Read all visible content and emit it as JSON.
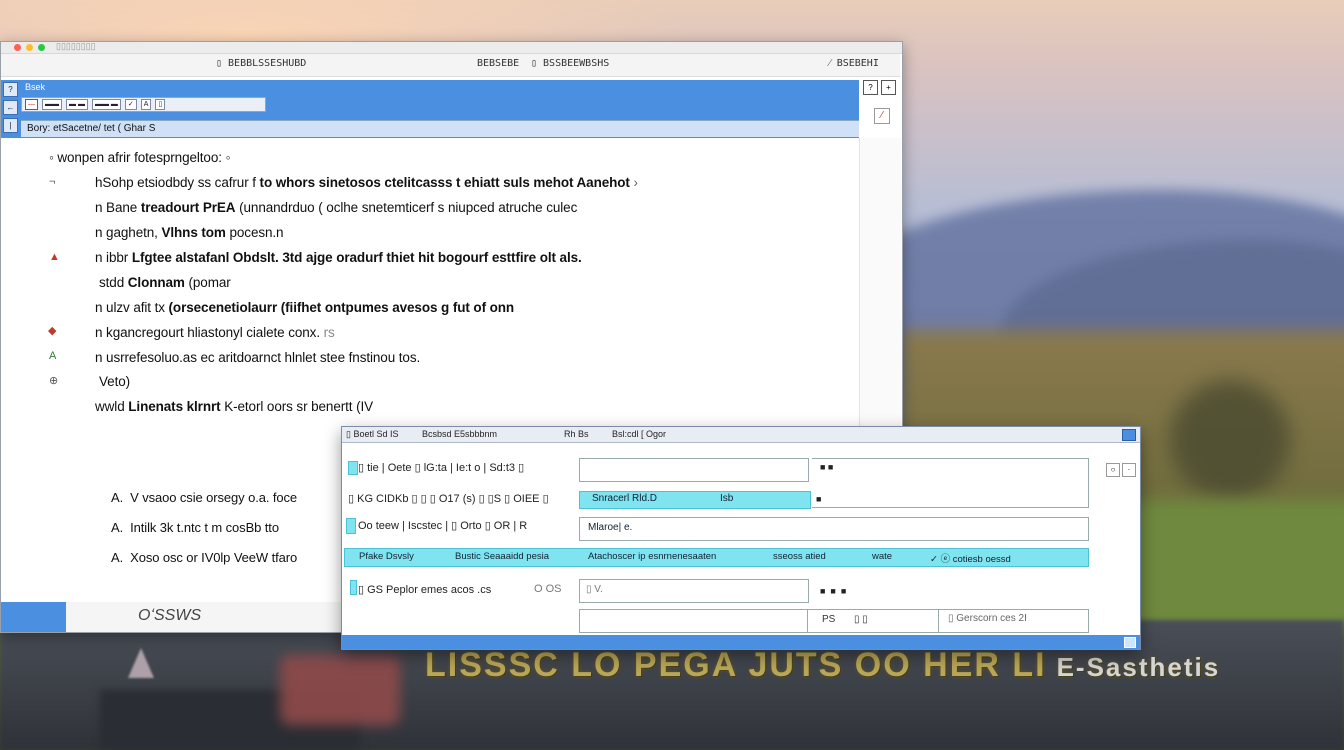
{
  "window": {
    "tab_label": "▯▯▯▯▯▯▯▯",
    "url": {
      "left": "▯ BEBBLSSESHUBD",
      "mid_a": "BEBSEBE",
      "mid_b": "▯ BSSBEEWBSHS",
      "right": "⁄  BSEBEHI"
    },
    "app_title": "Bsek",
    "toolbar_labels": [
      "—",
      "▬▬",
      "▬ ▬",
      "▬▬ ▬",
      "✓",
      "A",
      "▯"
    ],
    "breadcrumb": "Bory: etSacetne/ tet ( Ghar  S",
    "rail_icons": [
      "?",
      "←",
      "|"
    ],
    "window_controls": [
      "?",
      "+"
    ],
    "logo_text": "OʻSSWS"
  },
  "document": {
    "lines": [
      {
        "prefix": "◦",
        "text": "wonpen afrir fotesprngeltoo: ",
        "bold": "",
        "suffix": "◦"
      },
      {
        "prefix": "¬",
        "text": "hSohp etsiodbdy ss cafrur f ",
        "bold": "to whors sinetosos ctelitcasss t ehiatt suls mehot Aanehot",
        "suffix": "›"
      },
      {
        "prefix": "",
        "text": "n Bane ",
        "bold": "treadourt PrEA",
        "suffix": " (unnandrduo ( oclhe snetemticerf s niupced atruche culec"
      },
      {
        "prefix": "",
        "text": "n gaghetn, ",
        "bold": "Vlhns tom",
        "suffix": " pocesn.n"
      },
      {
        "prefix": "",
        "text": "n ibbr ",
        "bold": "Lfgtee alstafanl Obdslt. 3td ajge oradurf thiet hit bogourf esttfire olt als.",
        "suffix": ""
      },
      {
        "prefix": "",
        "text": "stdd ",
        "bold": "Clonnam",
        "suffix": " (pomar"
      },
      {
        "prefix": "",
        "text": "n ulzv afit tx ",
        "bold": "(orsecenetiolaurr (fiifhet ontpumes avesos g fut of onn",
        "suffix": ""
      },
      {
        "prefix": "",
        "text": "n kgancregourt hliastonyl cialete conx. ",
        "bold": "",
        "suffix": "rs"
      },
      {
        "prefix": "",
        "text": "n usrrefesoluo.as ec aritdoarnct hlnlet stee fnstinou tos.",
        "bold": "",
        "suffix": ""
      },
      {
        "prefix": "",
        "text": "Veto)",
        "bold": "",
        "suffix": ""
      },
      {
        "prefix": "",
        "text": "wwld ",
        "bold": "Linenats klrnrt",
        "suffix": " K-etorl oors sr benertt (IV"
      }
    ],
    "answers": [
      {
        "letter": "A.",
        "text": "V vsaoo csie orsegy o.a. foce"
      },
      {
        "letter": "A.",
        "text": "Intilk 3k t.ntc t m cosBb tto"
      },
      {
        "letter": "A.",
        "text": "Xoso osc or IV0lp VeeW tfaro"
      }
    ]
  },
  "dialog": {
    "title_parts": [
      "▯ Boetl Sd IS",
      "Bcsbsd E5sbbbnm",
      "Rh Bs",
      "Bsl:cdl [ Ogor"
    ],
    "rows": [
      {
        "label": "▯ tie | Oete ▯ lG:ta | Ie:t o | Sd:t3 ▯",
        "value": ""
      },
      {
        "label": "▯ KG CIDKb ▯ ▯ ▯ O17 (s) ▯ ▯S ▯ OIEE ▯",
        "value": "Snracerl Rld.D",
        "extra": "Isb"
      },
      {
        "label": "Oo teew | Iscstec | ▯ Orto ▯ OR | R",
        "value": "Mlaroe| e."
      },
      {
        "label": "Pfake Dsvsly",
        "value": "Bustic Seaaaidd pesia",
        "col3": "Atachoscer ip   esnrnenesaaten",
        "col4": "sseoss  atied",
        "col5": "wate",
        "col6": "✓ ⓔ  cotiesb oessd"
      },
      {
        "label": "▯ GS Peplor emes acos .cs",
        "value": "O OS",
        "extra": "▯ V."
      },
      {
        "label": "",
        "value": "PS",
        "col3": "▯ ▯",
        "col4": "▯ Gerscorn ces 2I"
      }
    ]
  },
  "banner": {
    "title_main": "LISSSC LO PEGA JUTS OO HER LI",
    "title_tail": "E-Sasthetis"
  },
  "colors": {
    "accent_blue": "#4a8fe0",
    "highlight_cyan": "#7fe4f0",
    "marker_red": "#c0392b",
    "marker_green": "#2e7d32"
  }
}
